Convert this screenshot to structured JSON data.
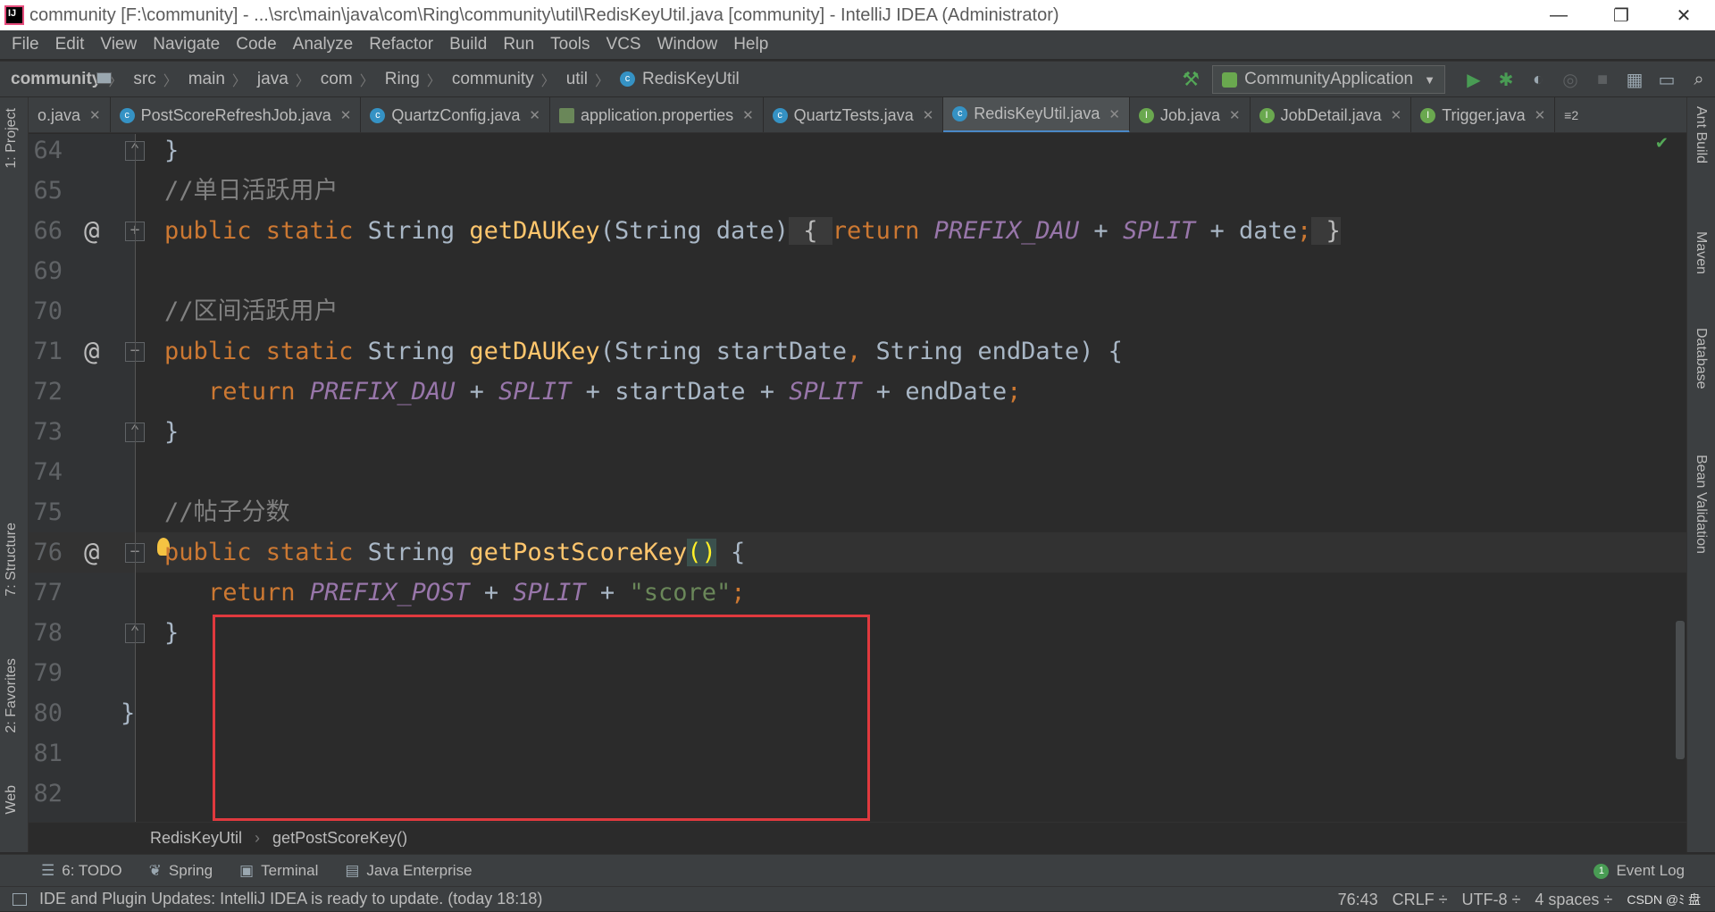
{
  "window": {
    "title": "community [F:\\community] - ...\\src\\main\\java\\com\\Ring\\community\\util\\RedisKeyUtil.java [community] - IntelliJ IDEA (Administrator)",
    "minimize": "—",
    "restore": "❐",
    "close": "✕"
  },
  "menu": [
    "File",
    "Edit",
    "View",
    "Navigate",
    "Code",
    "Analyze",
    "Refactor",
    "Build",
    "Run",
    "Tools",
    "VCS",
    "Window",
    "Help"
  ],
  "breadcrumb": [
    "community",
    "src",
    "main",
    "java",
    "com",
    "Ring",
    "community",
    "util",
    "RedisKeyUtil"
  ],
  "run_config": "CommunityApplication",
  "tabs": [
    {
      "label": "o.java",
      "icon": "class-icon"
    },
    {
      "label": "PostScoreRefreshJob.java",
      "icon": "class-icon"
    },
    {
      "label": "QuartzConfig.java",
      "icon": "class-icon"
    },
    {
      "label": "application.properties",
      "icon": "properties-icon"
    },
    {
      "label": "QuartzTests.java",
      "icon": "class-icon"
    },
    {
      "label": "RedisKeyUtil.java",
      "icon": "class-icon",
      "active": true
    },
    {
      "label": "Job.java",
      "icon": "interface-icon"
    },
    {
      "label": "JobDetail.java",
      "icon": "interface-icon"
    },
    {
      "label": "Trigger.java",
      "icon": "interface-icon"
    }
  ],
  "tab_overflow": "≡2",
  "left_tools": [
    "1: Project",
    "7: Structure",
    "2: Favorites",
    "Web"
  ],
  "right_tools": [
    "Ant Build",
    "Maven",
    "Database",
    "Bean Validation"
  ],
  "code_lines": [
    {
      "n": "64",
      "at": "",
      "fold": "⌃",
      "tokens": [
        {
          "c": "pl",
          "t": "}"
        }
      ],
      "indent": 0
    },
    {
      "n": "65",
      "at": "",
      "fold": "",
      "tokens": [
        {
          "c": "cmt",
          "t": "//单日活跃用户"
        }
      ],
      "indent": 0
    },
    {
      "n": "66",
      "at": "@",
      "fold": "+",
      "tokens": [
        {
          "c": "kw",
          "t": "public static "
        },
        {
          "c": "pl",
          "t": "String "
        },
        {
          "c": "fn",
          "t": "getDAUKey"
        },
        {
          "c": "pl",
          "t": "(String date)"
        },
        {
          "c": "fld",
          "t": " { "
        },
        {
          "c": "kw",
          "t": "return "
        },
        {
          "c": "cst",
          "t": "PREFIX_DAU"
        },
        {
          "c": "pl",
          "t": " + "
        },
        {
          "c": "cst",
          "t": "SPLIT"
        },
        {
          "c": "pl",
          "t": " + date"
        },
        {
          "c": "kw",
          "t": ";"
        },
        {
          "c": "fld",
          "t": " }"
        }
      ],
      "indent": 0
    },
    {
      "n": "69",
      "at": "",
      "fold": "",
      "tokens": [],
      "indent": 0
    },
    {
      "n": "70",
      "at": "",
      "fold": "",
      "tokens": [
        {
          "c": "cmt",
          "t": "//区间活跃用户"
        }
      ],
      "indent": 0
    },
    {
      "n": "71",
      "at": "@",
      "fold": "−",
      "tokens": [
        {
          "c": "kw",
          "t": "public static "
        },
        {
          "c": "pl",
          "t": "String "
        },
        {
          "c": "fn",
          "t": "getDAUKey"
        },
        {
          "c": "pl",
          "t": "(String startDate"
        },
        {
          "c": "kw",
          "t": ", "
        },
        {
          "c": "pl",
          "t": "String endDate) {"
        }
      ],
      "indent": 0
    },
    {
      "n": "72",
      "at": "",
      "fold": "",
      "tokens": [
        {
          "c": "kw",
          "t": "return "
        },
        {
          "c": "cst",
          "t": "PREFIX_DAU"
        },
        {
          "c": "pl",
          "t": " + "
        },
        {
          "c": "cst",
          "t": "SPLIT"
        },
        {
          "c": "pl",
          "t": " + startDate + "
        },
        {
          "c": "cst",
          "t": "SPLIT"
        },
        {
          "c": "pl",
          "t": " + endDate"
        },
        {
          "c": "kw",
          "t": ";"
        }
      ],
      "indent": 1
    },
    {
      "n": "73",
      "at": "",
      "fold": "⌃",
      "tokens": [
        {
          "c": "pl",
          "t": "}"
        }
      ],
      "indent": 0
    },
    {
      "n": "74",
      "at": "",
      "fold": "",
      "tokens": [],
      "indent": 0
    },
    {
      "n": "75",
      "at": "",
      "fold": "",
      "tokens": [
        {
          "c": "cmt",
          "t": "//帖子分数"
        }
      ],
      "indent": 0
    },
    {
      "n": "76",
      "at": "@",
      "fold": "−",
      "bulb": true,
      "cur": true,
      "tokens": [
        {
          "c": "kw",
          "t": "public static "
        },
        {
          "c": "pl",
          "t": "String "
        },
        {
          "c": "fn",
          "t": "getPostScoreKey"
        },
        {
          "c": "brk",
          "t": "()"
        },
        {
          "c": "pl",
          "t": " {"
        }
      ],
      "indent": 0
    },
    {
      "n": "77",
      "at": "",
      "fold": "",
      "tokens": [
        {
          "c": "kw",
          "t": "return "
        },
        {
          "c": "cst",
          "t": "PREFIX_POST"
        },
        {
          "c": "pl",
          "t": " + "
        },
        {
          "c": "cst",
          "t": "SPLIT"
        },
        {
          "c": "pl",
          "t": " + "
        },
        {
          "c": "str",
          "t": "\"score\""
        },
        {
          "c": "kw",
          "t": ";"
        }
      ],
      "indent": 1
    },
    {
      "n": "78",
      "at": "",
      "fold": "⌃",
      "tokens": [
        {
          "c": "pl",
          "t": "}"
        }
      ],
      "indent": 0
    },
    {
      "n": "79",
      "at": "",
      "fold": "",
      "tokens": [],
      "indent": 0
    },
    {
      "n": "80",
      "at": "",
      "fold": "",
      "tokens": [
        {
          "c": "pl",
          "t": "}"
        }
      ],
      "indent": -1
    },
    {
      "n": "81",
      "at": "",
      "fold": "",
      "tokens": [],
      "indent": 0
    },
    {
      "n": "82",
      "at": "",
      "fold": "",
      "tokens": [],
      "indent": 0
    }
  ],
  "editor_breadcrumb": [
    "RedisKeyUtil",
    "getPostScoreKey()"
  ],
  "tool_windows": [
    {
      "label": "6: TODO",
      "icon": "☰"
    },
    {
      "label": "Spring",
      "icon": "❦"
    },
    {
      "label": "Terminal",
      "icon": "▣"
    },
    {
      "label": "Java Enterprise",
      "icon": "▤"
    }
  ],
  "event_log": {
    "count": "1",
    "label": "Event Log"
  },
  "status": {
    "message": "IDE and Plugin Updates: IntelliJ IDEA is ready to update. (today 18:18)",
    "position": "76:43",
    "line_sep": "CRLF ÷",
    "encoding": "UTF-8 ÷",
    "indent": "4 spaces ÷",
    "watermark": "CSDN @ﾐ 盘",
    "lock": "🔒"
  },
  "colors": {
    "keyword": "#cc7832",
    "function": "#ffc66d",
    "comment": "#808080",
    "constant": "#9876aa",
    "string": "#6a8759",
    "highlight_box": "#e0393e"
  }
}
